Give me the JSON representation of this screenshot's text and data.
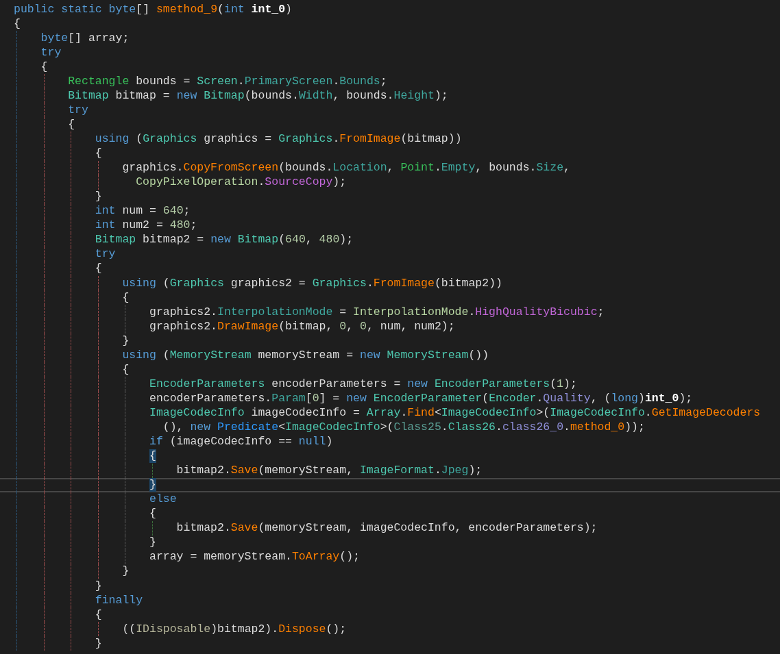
{
  "editor": {
    "lines": [
      {
        "tokens": [
          {
            "text": "public static byte",
            "kind": "kw"
          },
          {
            "text": "[] ",
            "kind": "plain"
          },
          {
            "text": "smethod_9",
            "kind": "method"
          },
          {
            "text": "(",
            "kind": "plain"
          },
          {
            "text": "int ",
            "kind": "kw"
          },
          {
            "text": "int_0",
            "kind": "param"
          },
          {
            "text": ")",
            "kind": "plain"
          }
        ]
      },
      {
        "tokens": [
          {
            "text": "{",
            "kind": "plain"
          }
        ],
        "children": [
          {
            "tokens": [
              {
                "text": "byte",
                "kind": "kw"
              },
              {
                "text": "[] array;",
                "kind": "plain"
              }
            ]
          },
          {
            "tokens": [
              {
                "text": "try",
                "kind": "kw"
              }
            ]
          },
          {
            "tokens": [
              {
                "text": "{",
                "kind": "plain"
              }
            ],
            "children": [
              {
                "tokens": [
                  {
                    "text": "Rectangle",
                    "kind": "struct"
                  },
                  {
                    "text": " bounds = ",
                    "kind": "plain"
                  },
                  {
                    "text": "Screen",
                    "kind": "type"
                  },
                  {
                    "text": ".",
                    "kind": "plain"
                  },
                  {
                    "text": "PrimaryScreen",
                    "kind": "prop"
                  },
                  {
                    "text": ".",
                    "kind": "plain"
                  },
                  {
                    "text": "Bounds",
                    "kind": "prop"
                  },
                  {
                    "text": ";",
                    "kind": "plain"
                  }
                ]
              },
              {
                "tokens": [
                  {
                    "text": "Bitmap",
                    "kind": "type"
                  },
                  {
                    "text": " bitmap = ",
                    "kind": "plain"
                  },
                  {
                    "text": "new ",
                    "kind": "kw"
                  },
                  {
                    "text": "Bitmap",
                    "kind": "type"
                  },
                  {
                    "text": "(bounds.",
                    "kind": "plain"
                  },
                  {
                    "text": "Width",
                    "kind": "prop"
                  },
                  {
                    "text": ", bounds.",
                    "kind": "plain"
                  },
                  {
                    "text": "Height",
                    "kind": "prop"
                  },
                  {
                    "text": ");",
                    "kind": "plain"
                  }
                ]
              },
              {
                "tokens": [
                  {
                    "text": "try",
                    "kind": "kw"
                  }
                ]
              },
              {
                "tokens": [
                  {
                    "text": "{",
                    "kind": "plain"
                  }
                ],
                "children": [
                  {
                    "tokens": [
                      {
                        "text": "using ",
                        "kind": "kw"
                      },
                      {
                        "text": "(",
                        "kind": "plain"
                      },
                      {
                        "text": "Graphics",
                        "kind": "type"
                      },
                      {
                        "text": " graphics = ",
                        "kind": "plain"
                      },
                      {
                        "text": "Graphics",
                        "kind": "type"
                      },
                      {
                        "text": ".",
                        "kind": "plain"
                      },
                      {
                        "text": "FromImage",
                        "kind": "method"
                      },
                      {
                        "text": "(bitmap))",
                        "kind": "plain"
                      }
                    ]
                  },
                  {
                    "tokens": [
                      {
                        "text": "{",
                        "kind": "plain"
                      }
                    ],
                    "children": [
                      {
                        "tokens": [
                          {
                            "text": "graphics.",
                            "kind": "plain"
                          },
                          {
                            "text": "CopyFromScreen",
                            "kind": "method"
                          },
                          {
                            "text": "(bounds.",
                            "kind": "plain"
                          },
                          {
                            "text": "Location",
                            "kind": "prop"
                          },
                          {
                            "text": ", ",
                            "kind": "plain"
                          },
                          {
                            "text": "Point",
                            "kind": "struct"
                          },
                          {
                            "text": ".",
                            "kind": "plain"
                          },
                          {
                            "text": "Empty",
                            "kind": "prop"
                          },
                          {
                            "text": ", bounds.",
                            "kind": "plain"
                          },
                          {
                            "text": "Size",
                            "kind": "prop"
                          },
                          {
                            "text": ",",
                            "kind": "plain"
                          }
                        ]
                      },
                      {
                        "wrapped": true,
                        "tokens": [
                          {
                            "text": "CopyPixelOperation",
                            "kind": "enumtype"
                          },
                          {
                            "text": ".",
                            "kind": "plain"
                          },
                          {
                            "text": "SourceCopy",
                            "kind": "enum"
                          },
                          {
                            "text": ");",
                            "kind": "plain"
                          }
                        ]
                      }
                    ]
                  },
                  {
                    "tokens": [
                      {
                        "text": "}",
                        "kind": "plain"
                      }
                    ]
                  },
                  {
                    "tokens": [
                      {
                        "text": "int",
                        "kind": "kw"
                      },
                      {
                        "text": " num = ",
                        "kind": "plain"
                      },
                      {
                        "text": "640",
                        "kind": "num"
                      },
                      {
                        "text": ";",
                        "kind": "plain"
                      }
                    ]
                  },
                  {
                    "tokens": [
                      {
                        "text": "int",
                        "kind": "kw"
                      },
                      {
                        "text": " num2 = ",
                        "kind": "plain"
                      },
                      {
                        "text": "480",
                        "kind": "num"
                      },
                      {
                        "text": ";",
                        "kind": "plain"
                      }
                    ]
                  },
                  {
                    "tokens": [
                      {
                        "text": "Bitmap",
                        "kind": "type"
                      },
                      {
                        "text": " bitmap2 = ",
                        "kind": "plain"
                      },
                      {
                        "text": "new ",
                        "kind": "kw"
                      },
                      {
                        "text": "Bitmap",
                        "kind": "type"
                      },
                      {
                        "text": "(",
                        "kind": "plain"
                      },
                      {
                        "text": "640",
                        "kind": "num"
                      },
                      {
                        "text": ", ",
                        "kind": "plain"
                      },
                      {
                        "text": "480",
                        "kind": "num"
                      },
                      {
                        "text": ");",
                        "kind": "plain"
                      }
                    ]
                  },
                  {
                    "tokens": [
                      {
                        "text": "try",
                        "kind": "kw"
                      }
                    ]
                  },
                  {
                    "tokens": [
                      {
                        "text": "{",
                        "kind": "plain"
                      }
                    ],
                    "children": [
                      {
                        "tokens": [
                          {
                            "text": "using ",
                            "kind": "kw"
                          },
                          {
                            "text": "(",
                            "kind": "plain"
                          },
                          {
                            "text": "Graphics",
                            "kind": "type"
                          },
                          {
                            "text": " graphics2 = ",
                            "kind": "plain"
                          },
                          {
                            "text": "Graphics",
                            "kind": "type"
                          },
                          {
                            "text": ".",
                            "kind": "plain"
                          },
                          {
                            "text": "FromImage",
                            "kind": "method"
                          },
                          {
                            "text": "(bitmap2))",
                            "kind": "plain"
                          }
                        ]
                      },
                      {
                        "tokens": [
                          {
                            "text": "{",
                            "kind": "plain"
                          }
                        ],
                        "children": [
                          {
                            "tokens": [
                              {
                                "text": "graphics2.",
                                "kind": "plain"
                              },
                              {
                                "text": "InterpolationMode",
                                "kind": "prop"
                              },
                              {
                                "text": " = ",
                                "kind": "plain"
                              },
                              {
                                "text": "InterpolationMode",
                                "kind": "enumtype"
                              },
                              {
                                "text": ".",
                                "kind": "plain"
                              },
                              {
                                "text": "HighQualityBicubic",
                                "kind": "enum"
                              },
                              {
                                "text": ";",
                                "kind": "plain"
                              }
                            ]
                          },
                          {
                            "tokens": [
                              {
                                "text": "graphics2.",
                                "kind": "plain"
                              },
                              {
                                "text": "DrawImage",
                                "kind": "method"
                              },
                              {
                                "text": "(bitmap, ",
                                "kind": "plain"
                              },
                              {
                                "text": "0",
                                "kind": "num"
                              },
                              {
                                "text": ", ",
                                "kind": "plain"
                              },
                              {
                                "text": "0",
                                "kind": "num"
                              },
                              {
                                "text": ", num, num2);",
                                "kind": "plain"
                              }
                            ]
                          }
                        ]
                      },
                      {
                        "tokens": [
                          {
                            "text": "}",
                            "kind": "plain"
                          }
                        ]
                      },
                      {
                        "tokens": [
                          {
                            "text": "using ",
                            "kind": "kw"
                          },
                          {
                            "text": "(",
                            "kind": "plain"
                          },
                          {
                            "text": "MemoryStream",
                            "kind": "type"
                          },
                          {
                            "text": " memoryStream = ",
                            "kind": "plain"
                          },
                          {
                            "text": "new ",
                            "kind": "kw"
                          },
                          {
                            "text": "MemoryStream",
                            "kind": "type"
                          },
                          {
                            "text": "())",
                            "kind": "plain"
                          }
                        ]
                      },
                      {
                        "tokens": [
                          {
                            "text": "{",
                            "kind": "plain"
                          }
                        ],
                        "children": [
                          {
                            "tokens": [
                              {
                                "text": "EncoderParameters",
                                "kind": "type"
                              },
                              {
                                "text": " encoderParameters = ",
                                "kind": "plain"
                              },
                              {
                                "text": "new ",
                                "kind": "kw"
                              },
                              {
                                "text": "EncoderParameters",
                                "kind": "type"
                              },
                              {
                                "text": "(",
                                "kind": "plain"
                              },
                              {
                                "text": "1",
                                "kind": "num"
                              },
                              {
                                "text": ");",
                                "kind": "plain"
                              }
                            ]
                          },
                          {
                            "tokens": [
                              {
                                "text": "encoderParameters.",
                                "kind": "plain"
                              },
                              {
                                "text": "Param",
                                "kind": "prop"
                              },
                              {
                                "text": "[",
                                "kind": "plain"
                              },
                              {
                                "text": "0",
                                "kind": "num"
                              },
                              {
                                "text": "] = ",
                                "kind": "plain"
                              },
                              {
                                "text": "new ",
                                "kind": "kw"
                              },
                              {
                                "text": "EncoderParameter",
                                "kind": "type"
                              },
                              {
                                "text": "(",
                                "kind": "plain"
                              },
                              {
                                "text": "Encoder",
                                "kind": "type"
                              },
                              {
                                "text": ".",
                                "kind": "plain"
                              },
                              {
                                "text": "Quality",
                                "kind": "field"
                              },
                              {
                                "text": ", (",
                                "kind": "plain"
                              },
                              {
                                "text": "long",
                                "kind": "kw"
                              },
                              {
                                "text": ")",
                                "kind": "plain"
                              },
                              {
                                "text": "int_0",
                                "kind": "param"
                              },
                              {
                                "text": ");",
                                "kind": "plain"
                              }
                            ]
                          },
                          {
                            "tokens": [
                              {
                                "text": "ImageCodecInfo",
                                "kind": "type"
                              },
                              {
                                "text": " imageCodecInfo = ",
                                "kind": "plain"
                              },
                              {
                                "text": "Array",
                                "kind": "type"
                              },
                              {
                                "text": ".",
                                "kind": "plain"
                              },
                              {
                                "text": "Find",
                                "kind": "method"
                              },
                              {
                                "text": "<",
                                "kind": "plain"
                              },
                              {
                                "text": "ImageCodecInfo",
                                "kind": "type"
                              },
                              {
                                "text": ">(",
                                "kind": "plain"
                              },
                              {
                                "text": "ImageCodecInfo",
                                "kind": "type"
                              },
                              {
                                "text": ".",
                                "kind": "plain"
                              },
                              {
                                "text": "GetImageDecoders",
                                "kind": "method"
                              }
                            ]
                          },
                          {
                            "wrapped": true,
                            "tokens": [
                              {
                                "text": "(), ",
                                "kind": "plain"
                              },
                              {
                                "text": "new ",
                                "kind": "kw"
                              },
                              {
                                "text": "Predicate",
                                "kind": "delegate"
                              },
                              {
                                "text": "<",
                                "kind": "plain"
                              },
                              {
                                "text": "ImageCodecInfo",
                                "kind": "type"
                              },
                              {
                                "text": ">(",
                                "kind": "plain"
                              },
                              {
                                "text": "Class25",
                                "kind": "dim"
                              },
                              {
                                "text": ".",
                                "kind": "plain"
                              },
                              {
                                "text": "Class26",
                                "kind": "type"
                              },
                              {
                                "text": ".",
                                "kind": "plain"
                              },
                              {
                                "text": "class26_0",
                                "kind": "field"
                              },
                              {
                                "text": ".",
                                "kind": "plain"
                              },
                              {
                                "text": "method_0",
                                "kind": "method"
                              },
                              {
                                "text": "));",
                                "kind": "plain"
                              }
                            ]
                          },
                          {
                            "tokens": [
                              {
                                "text": "if ",
                                "kind": "kw"
                              },
                              {
                                "text": "(imageCodecInfo == ",
                                "kind": "plain"
                              },
                              {
                                "text": "null",
                                "kind": "kw"
                              },
                              {
                                "text": ")",
                                "kind": "plain"
                              }
                            ]
                          },
                          {
                            "brace_matched": true,
                            "tokens": [
                              {
                                "text": "{",
                                "kind": "plain"
                              }
                            ],
                            "children": [
                              {
                                "tokens": [
                                  {
                                    "text": "bitmap2.",
                                    "kind": "plain"
                                  },
                                  {
                                    "text": "Save",
                                    "kind": "method"
                                  },
                                  {
                                    "text": "(memoryStream, ",
                                    "kind": "plain"
                                  },
                                  {
                                    "text": "ImageFormat",
                                    "kind": "type"
                                  },
                                  {
                                    "text": ".",
                                    "kind": "plain"
                                  },
                                  {
                                    "text": "Jpeg",
                                    "kind": "prop"
                                  },
                                  {
                                    "text": ");",
                                    "kind": "plain"
                                  }
                                ]
                              }
                            ]
                          },
                          {
                            "brace_matched": true,
                            "current": true,
                            "tokens": [
                              {
                                "text": "}",
                                "kind": "plain"
                              }
                            ]
                          },
                          {
                            "tokens": [
                              {
                                "text": "else",
                                "kind": "kw"
                              }
                            ]
                          },
                          {
                            "tokens": [
                              {
                                "text": "{",
                                "kind": "plain"
                              }
                            ],
                            "children": [
                              {
                                "tokens": [
                                  {
                                    "text": "bitmap2.",
                                    "kind": "plain"
                                  },
                                  {
                                    "text": "Save",
                                    "kind": "method"
                                  },
                                  {
                                    "text": "(memoryStream, imageCodecInfo, encoderParameters);",
                                    "kind": "plain"
                                  }
                                ]
                              }
                            ]
                          },
                          {
                            "tokens": [
                              {
                                "text": "}",
                                "kind": "plain"
                              }
                            ]
                          },
                          {
                            "tokens": [
                              {
                                "text": "array = memoryStream.",
                                "kind": "plain"
                              },
                              {
                                "text": "ToArray",
                                "kind": "method"
                              },
                              {
                                "text": "();",
                                "kind": "plain"
                              }
                            ]
                          }
                        ]
                      },
                      {
                        "tokens": [
                          {
                            "text": "}",
                            "kind": "plain"
                          }
                        ]
                      }
                    ]
                  },
                  {
                    "tokens": [
                      {
                        "text": "}",
                        "kind": "plain"
                      }
                    ]
                  },
                  {
                    "tokens": [
                      {
                        "text": "finally",
                        "kind": "kw"
                      }
                    ]
                  },
                  {
                    "tokens": [
                      {
                        "text": "{",
                        "kind": "plain"
                      }
                    ],
                    "children": [
                      {
                        "tokens": [
                          {
                            "text": "((",
                            "kind": "plain"
                          },
                          {
                            "text": "IDisposable",
                            "kind": "iface"
                          },
                          {
                            "text": ")bitmap2).",
                            "kind": "plain"
                          },
                          {
                            "text": "Dispose",
                            "kind": "method"
                          },
                          {
                            "text": "();",
                            "kind": "plain"
                          }
                        ]
                      }
                    ]
                  },
                  {
                    "tokens": [
                      {
                        "text": "}",
                        "kind": "plain"
                      }
                    ]
                  }
                ]
              }
            ]
          }
        ]
      }
    ]
  }
}
